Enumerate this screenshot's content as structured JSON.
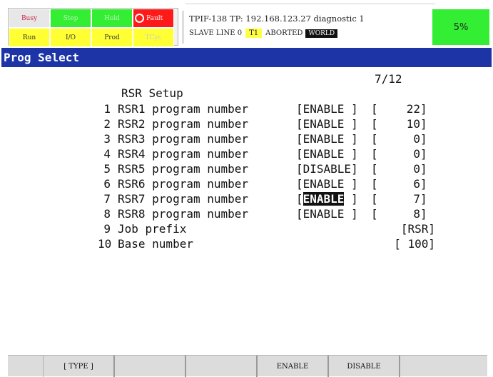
{
  "status": {
    "busy": "Busy",
    "step": "Step",
    "hold": "Hold",
    "fault": "Fault",
    "run": "Run",
    "io": "I/O",
    "prod": "Prod",
    "tcyc": "TCyc"
  },
  "header": {
    "line1": "TPIF-138 TP: 192.168.123.27 diagnostic 1",
    "slave": "SLAVE LINE 0",
    "t1": "T1",
    "state": "ABORTED",
    "world": "WORLD",
    "percent": "5%"
  },
  "title": "Prog Select",
  "page_indicator": "7/12",
  "section_title": "RSR Setup",
  "rows": [
    {
      "num": "1",
      "label": "RSR1 program number",
      "val": "[ENABLE ]",
      "open": "[",
      "n": "22",
      "close": "]"
    },
    {
      "num": "2",
      "label": "RSR2 program number",
      "val": "[ENABLE ]",
      "open": "[",
      "n": "10",
      "close": "]"
    },
    {
      "num": "3",
      "label": "RSR3 program number",
      "val": "[ENABLE ]",
      "open": "[",
      "n": "0",
      "close": "]"
    },
    {
      "num": "4",
      "label": "RSR4 program number",
      "val": "[ENABLE ]",
      "open": "[",
      "n": "0",
      "close": "]"
    },
    {
      "num": "5",
      "label": "RSR5 program number",
      "val": "[DISABLE]",
      "open": "[",
      "n": "0",
      "close": "]"
    },
    {
      "num": "6",
      "label": "RSR6 program number",
      "val": "[ENABLE ]",
      "open": "[",
      "n": "6",
      "close": "]"
    },
    {
      "num": "7",
      "label": "RSR7 program number",
      "val_open": "[",
      "val_hl": "ENABLE",
      "val_close": " ]",
      "open": "[",
      "n": "7",
      "close": "]"
    },
    {
      "num": "8",
      "label": "RSR8 program number",
      "val": "[ENABLE ]",
      "open": "[",
      "n": "8",
      "close": "]"
    },
    {
      "num": "9",
      "label": "Job prefix",
      "tail": "[RSR]"
    },
    {
      "num": "10",
      "label": "Base number",
      "tail": "[ 100]"
    }
  ],
  "fkeys": [
    "",
    "[ TYPE ]",
    "",
    "",
    "ENABLE",
    "DISABLE",
    ""
  ],
  "colors": {
    "title_bar": "#1c34a6",
    "green": "#33ee33",
    "yellow": "#ffff33",
    "red": "#ff1a1a"
  }
}
